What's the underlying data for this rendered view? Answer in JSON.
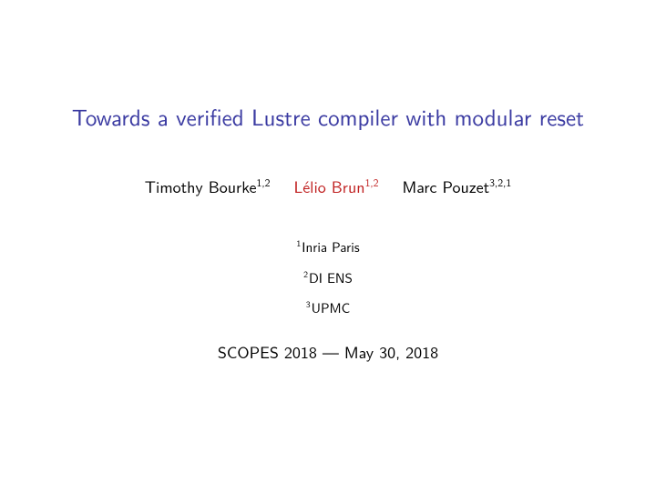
{
  "title": "Towards a verified Lustre compiler with modular reset",
  "authors": [
    {
      "name": "Timothy Bourke",
      "affil": "1,2",
      "highlight": false
    },
    {
      "name": "Lélio Brun",
      "affil": "1,2",
      "highlight": true
    },
    {
      "name": "Marc Pouzet",
      "affil": "3,2,1",
      "highlight": false
    }
  ],
  "affiliations": [
    {
      "num": "1",
      "text": "Inria Paris"
    },
    {
      "num": "2",
      "text": "DI ENS"
    },
    {
      "num": "3",
      "text": "UPMC"
    }
  ],
  "venue": "SCOPES 2018 — May 30, 2018"
}
